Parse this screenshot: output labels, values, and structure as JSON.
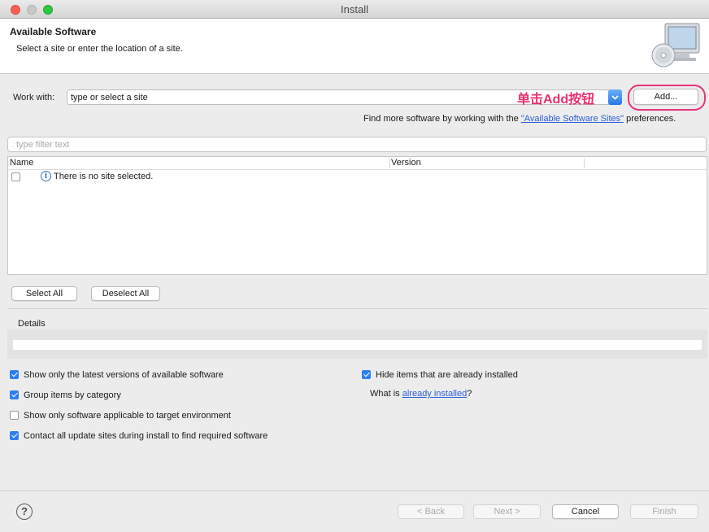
{
  "window": {
    "title": "Install"
  },
  "header": {
    "title": "Available Software",
    "subtitle": "Select a site or enter the location of a site.",
    "icon": "install-monitor-cd-icon"
  },
  "work_with": {
    "label": "Work with:",
    "value": "type or select a site",
    "add_label": "Add...",
    "annotation": "单击Add按钮",
    "more_prefix": "Find more software by working with the ",
    "more_link": "\"Available Software Sites\"",
    "more_suffix": " preferences."
  },
  "filter": {
    "placeholder": "type filter text"
  },
  "table": {
    "columns": [
      "Name",
      "Version"
    ],
    "message": "There is no site selected."
  },
  "buttons": {
    "select_all": "Select All",
    "deselect_all": "Deselect All",
    "back": "< Back",
    "next": "Next >",
    "cancel": "Cancel",
    "finish": "Finish"
  },
  "details": {
    "label": "Details"
  },
  "options": {
    "show_latest": {
      "label": "Show only the latest versions of available software",
      "checked": true
    },
    "group_by_category": {
      "label": "Group items by category",
      "checked": true
    },
    "show_applicable": {
      "label": "Show only software applicable to target environment",
      "checked": false
    },
    "contact_all": {
      "label": "Contact all update sites during install to find required software",
      "checked": true
    },
    "hide_installed": {
      "label": "Hide items that are already installed",
      "checked": true
    },
    "what_is_prefix": "What is ",
    "what_is_link": "already installed",
    "what_is_suffix": "?"
  },
  "colors": {
    "accent": "#2f7ef0",
    "annotation": "#ea2f6e",
    "link": "#2d5ed8"
  }
}
